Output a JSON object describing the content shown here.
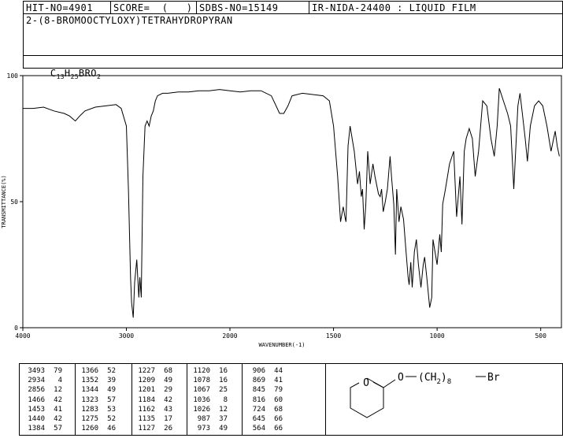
{
  "header": {
    "hit_no": "HIT-NO=4901",
    "score": "SCORE=  (   )",
    "sdbs_no": "SDBS-NO=15149",
    "ir_info": "IR-NIDA-24400 : LIQUID FILM"
  },
  "compound_name": "2-(8-BROMOOCTYLOXY)TETRAHYDROPYRAN",
  "formula": {
    "c": "C",
    "c_sub": "13",
    "h": "H",
    "h_sub": "25",
    "rest": "BRO",
    "o_sub": "2"
  },
  "chart_data": {
    "type": "line",
    "xlabel": "WAVENUMBER(-1)",
    "ylabel": "TRANSMITTANCE(%)",
    "xlim": [
      4000,
      400
    ],
    "ylim": [
      0,
      100
    ],
    "x_ticks": [
      4000,
      3000,
      2000,
      1500,
      1000,
      500
    ],
    "y_ticks": [
      0,
      50,
      100
    ],
    "x": [
      4000,
      3900,
      3800,
      3700,
      3600,
      3550,
      3493,
      3450,
      3400,
      3300,
      3200,
      3100,
      3050,
      3000,
      2980,
      2960,
      2950,
      2934,
      2920,
      2900,
      2880,
      2870,
      2856,
      2840,
      2820,
      2800,
      2780,
      2760,
      2740,
      2720,
      2700,
      2650,
      2600,
      2500,
      2400,
      2300,
      2200,
      2100,
      2000,
      1950,
      1900,
      1850,
      1800,
      1760,
      1740,
      1720,
      1700,
      1650,
      1600,
      1550,
      1520,
      1500,
      1480,
      1466,
      1453,
      1445,
      1440,
      1430,
      1420,
      1400,
      1384,
      1375,
      1366,
      1360,
      1352,
      1344,
      1335,
      1323,
      1310,
      1300,
      1283,
      1275,
      1268,
      1260,
      1250,
      1240,
      1227,
      1220,
      1209,
      1201,
      1195,
      1184,
      1175,
      1162,
      1150,
      1140,
      1135,
      1127,
      1120,
      1110,
      1100,
      1090,
      1078,
      1067,
      1060,
      1050,
      1036,
      1026,
      1020,
      1010,
      1000,
      987,
      980,
      973,
      960,
      940,
      920,
      906,
      890,
      880,
      869,
      860,
      845,
      830,
      816,
      800,
      780,
      760,
      740,
      724,
      710,
      700,
      680,
      660,
      645,
      630,
      610,
      600,
      590,
      575,
      564,
      550,
      530,
      510,
      490,
      470,
      450,
      430,
      420,
      410,
      400
    ],
    "y": [
      87,
      87,
      87.5,
      86,
      85,
      84,
      82,
      84,
      86,
      87.5,
      88,
      88.5,
      87,
      80,
      55,
      20,
      10,
      4,
      18,
      27,
      12,
      20,
      12,
      60,
      80,
      82,
      80,
      84,
      86,
      90,
      92,
      93,
      93,
      93.5,
      93.5,
      94,
      94,
      94.5,
      94,
      93.5,
      94,
      94,
      92,
      85,
      85,
      88,
      92,
      93,
      92.5,
      92,
      90,
      80,
      60,
      42,
      48,
      44,
      42,
      72,
      80,
      70,
      57,
      62,
      52,
      55,
      39,
      49,
      70,
      57,
      65,
      60,
      53,
      52,
      55,
      46,
      50,
      55,
      68,
      60,
      49,
      29,
      55,
      42,
      48,
      43,
      30,
      20,
      17,
      26,
      16,
      30,
      35,
      25,
      16,
      25,
      28,
      20,
      8,
      12,
      35,
      30,
      25,
      37,
      30,
      49,
      55,
      65,
      70,
      44,
      60,
      41,
      70,
      75,
      79,
      75,
      60,
      70,
      90,
      88,
      75,
      68,
      80,
      95,
      90,
      85,
      80,
      55,
      88,
      93,
      86,
      75,
      66,
      80,
      88,
      90,
      88,
      80,
      70,
      78,
      72,
      68
    ],
    "peaks": [
      {
        "wavenumber": 3493,
        "transmittance": 79
      },
      {
        "wavenumber": 2934,
        "transmittance": 4
      },
      {
        "wavenumber": 2856,
        "transmittance": 12
      },
      {
        "wavenumber": 1466,
        "transmittance": 42
      },
      {
        "wavenumber": 1453,
        "transmittance": 41
      },
      {
        "wavenumber": 1440,
        "transmittance": 42
      },
      {
        "wavenumber": 1384,
        "transmittance": 57
      },
      {
        "wavenumber": 1366,
        "transmittance": 52
      },
      {
        "wavenumber": 1352,
        "transmittance": 39
      },
      {
        "wavenumber": 1344,
        "transmittance": 49
      },
      {
        "wavenumber": 1323,
        "transmittance": 57
      },
      {
        "wavenumber": 1283,
        "transmittance": 53
      },
      {
        "wavenumber": 1275,
        "transmittance": 52
      },
      {
        "wavenumber": 1260,
        "transmittance": 46
      },
      {
        "wavenumber": 1227,
        "transmittance": 68
      },
      {
        "wavenumber": 1209,
        "transmittance": 49
      },
      {
        "wavenumber": 1201,
        "transmittance": 29
      },
      {
        "wavenumber": 1184,
        "transmittance": 42
      },
      {
        "wavenumber": 1162,
        "transmittance": 43
      },
      {
        "wavenumber": 1135,
        "transmittance": 17
      },
      {
        "wavenumber": 1127,
        "transmittance": 26
      },
      {
        "wavenumber": 1120,
        "transmittance": 16
      },
      {
        "wavenumber": 1078,
        "transmittance": 16
      },
      {
        "wavenumber": 1067,
        "transmittance": 25
      },
      {
        "wavenumber": 1036,
        "transmittance": 8
      },
      {
        "wavenumber": 1026,
        "transmittance": 12
      },
      {
        "wavenumber": 987,
        "transmittance": 37
      },
      {
        "wavenumber": 973,
        "transmittance": 49
      },
      {
        "wavenumber": 906,
        "transmittance": 44
      },
      {
        "wavenumber": 869,
        "transmittance": 41
      },
      {
        "wavenumber": 845,
        "transmittance": 79
      },
      {
        "wavenumber": 816,
        "transmittance": 60
      },
      {
        "wavenumber": 724,
        "transmittance": 68
      },
      {
        "wavenumber": 645,
        "transmittance": 66
      },
      {
        "wavenumber": 564,
        "transmittance": 66
      }
    ]
  },
  "peak_columns": [
    [
      [
        "3493",
        "79"
      ],
      [
        "2934",
        "4"
      ],
      [
        "2856",
        "12"
      ],
      [
        "1466",
        "42"
      ],
      [
        "1453",
        "41"
      ],
      [
        "1440",
        "42"
      ],
      [
        "1384",
        "57"
      ]
    ],
    [
      [
        "1366",
        "52"
      ],
      [
        "1352",
        "39"
      ],
      [
        "1344",
        "49"
      ],
      [
        "1323",
        "57"
      ],
      [
        "1283",
        "53"
      ],
      [
        "1275",
        "52"
      ],
      [
        "1260",
        "46"
      ]
    ],
    [
      [
        "1227",
        "68"
      ],
      [
        "1209",
        "49"
      ],
      [
        "1201",
        "29"
      ],
      [
        "1184",
        "42"
      ],
      [
        "1162",
        "43"
      ],
      [
        "1135",
        "17"
      ],
      [
        "1127",
        "26"
      ]
    ],
    [
      [
        "1120",
        "16"
      ],
      [
        "1078",
        "16"
      ],
      [
        "1067",
        "25"
      ],
      [
        "1036",
        "8"
      ],
      [
        "1026",
        "12"
      ],
      [
        "987",
        "37"
      ],
      [
        "973",
        "49"
      ]
    ],
    [
      [
        "906",
        "44"
      ],
      [
        "869",
        "41"
      ],
      [
        "845",
        "79"
      ],
      [
        "816",
        "60"
      ],
      [
        "724",
        "68"
      ],
      [
        "645",
        "66"
      ],
      [
        "564",
        "66"
      ]
    ]
  ],
  "structure": {
    "ring_o": "O",
    "link_o": "O",
    "chain_open": "(CH",
    "chain_sub": "2",
    "chain_close": ")",
    "chain_count": "8",
    "br": "Br"
  }
}
